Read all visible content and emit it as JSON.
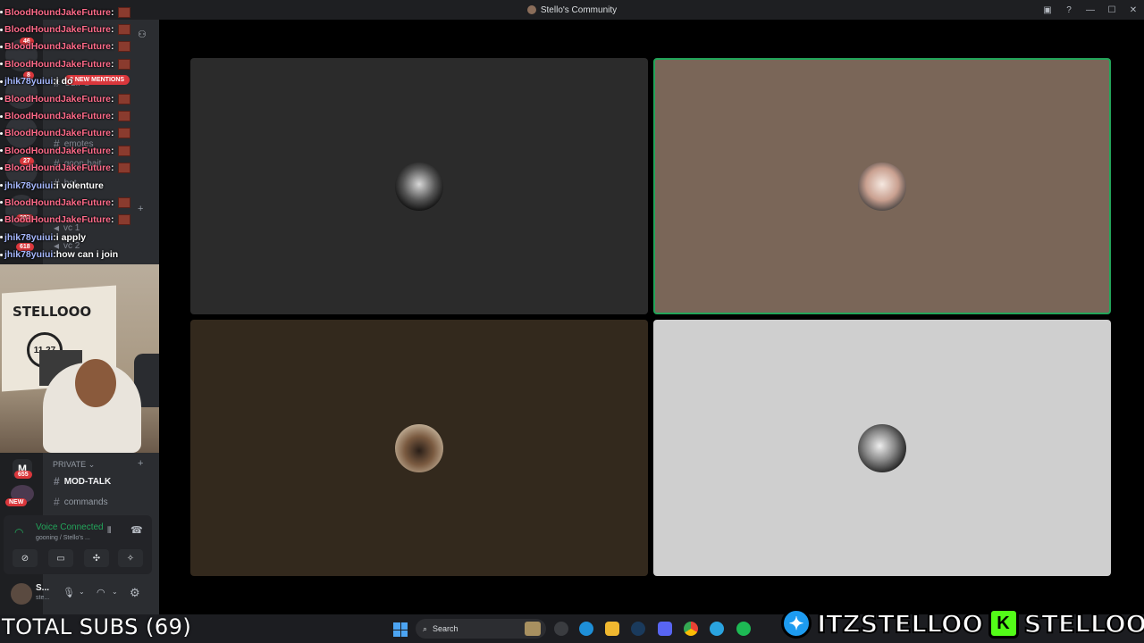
{
  "window": {
    "title": "Stello's Community",
    "controls": [
      "inbox",
      "help",
      "minimize",
      "maximize",
      "close"
    ]
  },
  "sidebar": {
    "servers": [
      {
        "badge": "46"
      },
      {
        "badge": "8"
      },
      {
        "badge": "27"
      },
      {
        "badge": "207"
      },
      {
        "badge": "618"
      }
    ],
    "mentions_pill": "2 NEW MENTIONS",
    "channels": [
      {
        "label": "CLIPS"
      },
      {
        "label": "emotes"
      },
      {
        "label": "goon-bait"
      },
      {
        "label": "bot"
      },
      {
        "label": "vc 1"
      },
      {
        "label": "vc 2"
      }
    ],
    "private_header": "PRIVATE",
    "private_channels": [
      {
        "label": "MOD-TALK"
      },
      {
        "label": "commands"
      }
    ],
    "server_badge_bottom": "655",
    "new_badge": "NEW"
  },
  "chat": {
    "messages": [
      {
        "user": "BloodHoundJakeFuture",
        "text": "",
        "emote": true,
        "color": "red"
      },
      {
        "user": "BloodHoundJakeFuture",
        "text": "",
        "emote": true,
        "color": "red"
      },
      {
        "user": "BloodHoundJakeFuture",
        "text": "",
        "emote": true,
        "color": "red"
      },
      {
        "user": "BloodHoundJakeFuture",
        "text": "",
        "emote": true,
        "color": "red"
      },
      {
        "user": "jhik78yuiui",
        "text": "i do",
        "emote": false,
        "color": "blue"
      },
      {
        "user": "BloodHoundJakeFuture",
        "text": "",
        "emote": true,
        "color": "red"
      },
      {
        "user": "BloodHoundJakeFuture",
        "text": "",
        "emote": true,
        "color": "red"
      },
      {
        "user": "BloodHoundJakeFuture",
        "text": "",
        "emote": true,
        "color": "red"
      },
      {
        "user": "BloodHoundJakeFuture",
        "text": "",
        "emote": true,
        "color": "red"
      },
      {
        "user": "BloodHoundJakeFuture",
        "text": "",
        "emote": true,
        "color": "red"
      },
      {
        "user": "jhik78yuiui",
        "text": "i volenture",
        "emote": false,
        "color": "blue"
      },
      {
        "user": "BloodHoundJakeFuture",
        "text": "",
        "emote": true,
        "color": "red"
      },
      {
        "user": "BloodHoundJakeFuture",
        "text": "",
        "emote": true,
        "color": "red"
      },
      {
        "user": "jhik78yuiui",
        "text": "i apply",
        "emote": false,
        "color": "blue"
      },
      {
        "user": "jhik78yuiui",
        "text": "how can i join",
        "emote": false,
        "color": "blue"
      }
    ],
    "separator": " : "
  },
  "webcam": {
    "banner_text": "STELLOOO",
    "box_text": "11.27"
  },
  "voice": {
    "status": "Voice Connected",
    "location": "gooning / Stello's ...",
    "buttons": [
      "camera-off",
      "screen-share",
      "activities",
      "soundboard"
    ]
  },
  "user": {
    "name": "S...",
    "status": "ste..."
  },
  "video_grid": {
    "tiles": [
      {
        "name": "tile-1",
        "bg": "#2b2b2b",
        "speaking": false
      },
      {
        "name": "tile-2",
        "bg": "#7a6658",
        "speaking": true
      },
      {
        "name": "tile-3",
        "bg": "#33291d",
        "speaking": false
      },
      {
        "name": "tile-4",
        "bg": "#cfcfcf",
        "speaking": false
      }
    ]
  },
  "taskbar": {
    "search_label": "Search",
    "subs_label": "TOTAL SUBS (69)",
    "apps": [
      "settings",
      "edge",
      "file-explorer",
      "steam",
      "discord",
      "chrome",
      "telegram",
      "spotify"
    ]
  },
  "socials": {
    "twitter": "ITZSTELLOO",
    "kick": "STELLOOO"
  },
  "colors": {
    "accent_green": "#23a55a",
    "mention_red": "#da373c",
    "kick_green": "#53fc18",
    "twitter_blue": "#1d9bf0"
  }
}
